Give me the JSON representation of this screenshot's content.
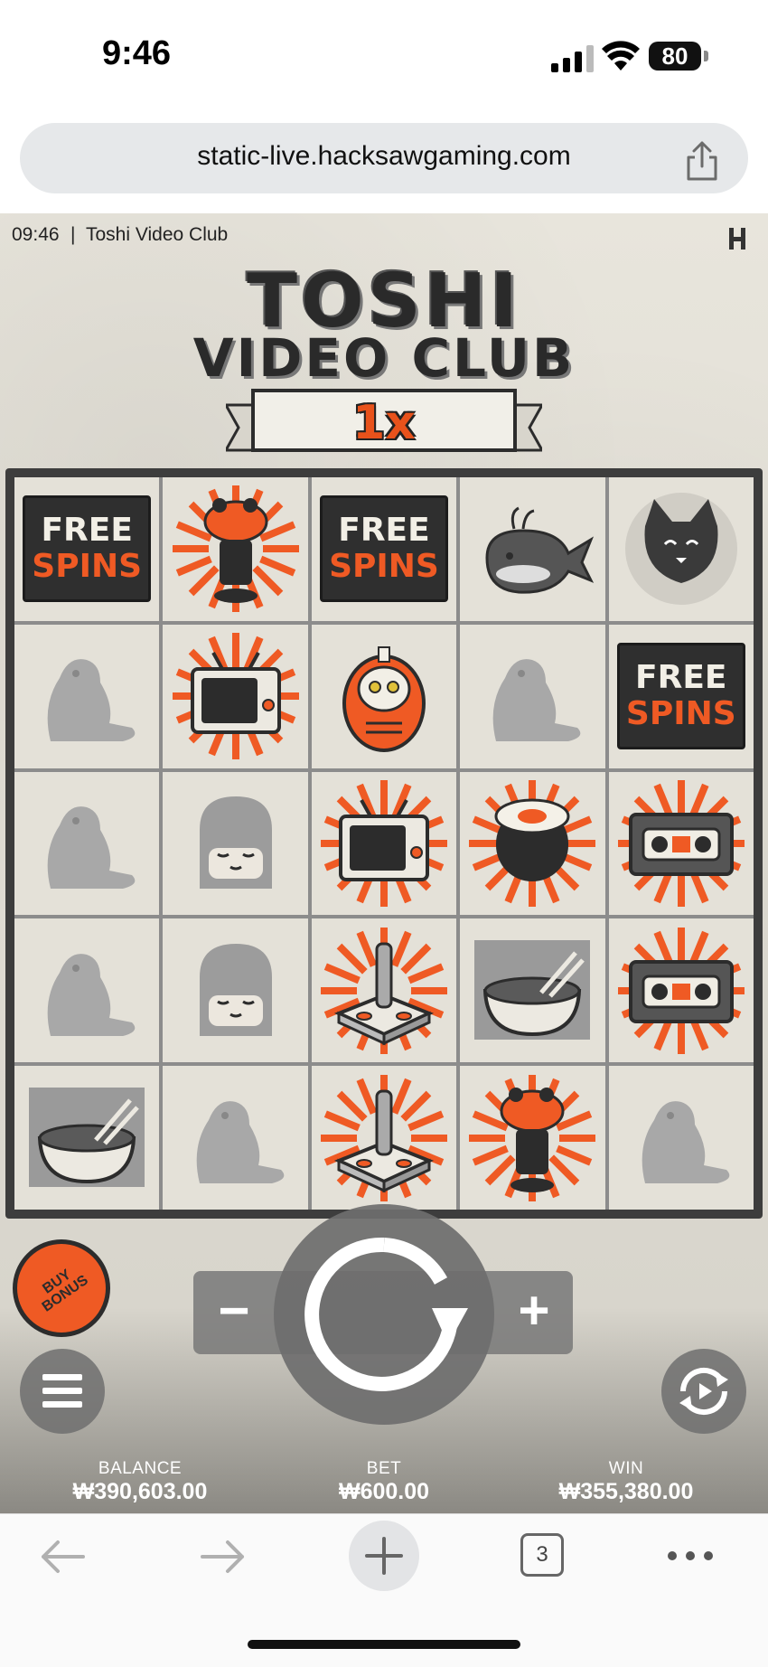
{
  "status_bar": {
    "time": "9:46",
    "battery": "80",
    "icons": [
      "signal-icon",
      "wifi-icon",
      "battery-icon"
    ]
  },
  "browser": {
    "url": "static-live.hacksawgaming.com",
    "share_icon": "share-icon",
    "tab_count": "3"
  },
  "game": {
    "clock": "09:46",
    "separator": "|",
    "title": "Toshi Video Club",
    "logo_line1": "TOSHI",
    "logo_line2": "VIDEO CLUB",
    "multiplier": "1x",
    "grid": [
      [
        "free-spins",
        "frog",
        "free-spins",
        "whale",
        "cat"
      ],
      [
        "beaver",
        "tv",
        "daruma",
        "beaver",
        "free-spins"
      ],
      [
        "beaver",
        "ninja",
        "tv",
        "sushi",
        "vhs"
      ],
      [
        "beaver",
        "ninja",
        "joystick",
        "bowl",
        "vhs"
      ],
      [
        "bowl",
        "beaver",
        "joystick",
        "frog",
        "beaver"
      ]
    ],
    "free_spins_top": "FREE",
    "free_spins_bottom": "SPINS",
    "buy_bonus_line1": "BUY",
    "buy_bonus_line2": "BONUS",
    "minus_label": "−",
    "plus_label": "+",
    "balance_label": "BALANCE",
    "balance_value": "₩390,603.00",
    "bet_label": "BET",
    "bet_value": "₩600.00",
    "win_label": "WIN",
    "win_value": "₩355,380.00"
  },
  "colors": {
    "accent": "#ef5a24",
    "dark": "#2c2c2c",
    "panel": "#e4e1d8"
  }
}
